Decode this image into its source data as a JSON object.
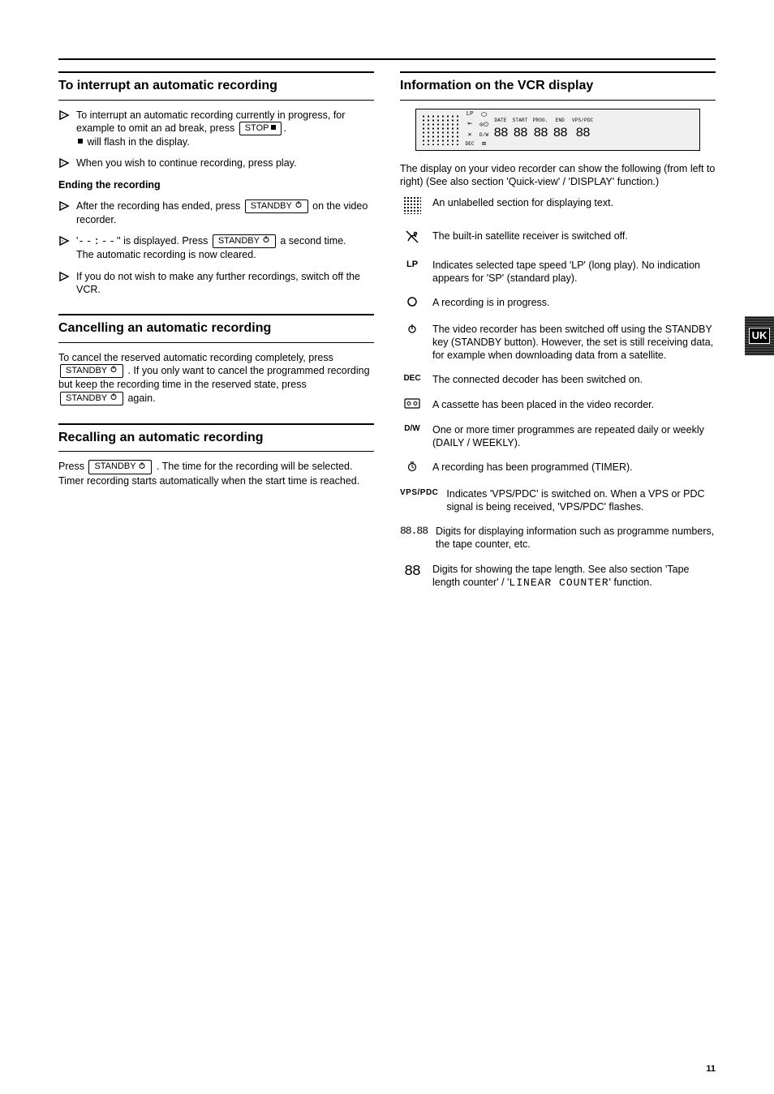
{
  "sections": {
    "interrupt": {
      "title": "To interrupt an automatic recording",
      "step1_a": "To interrupt an automatic recording currently in progress, for example to omit an ad break, press ",
      "stop_text": "STOP ",
      "step1_b": ".",
      "step1_sub": " will flash in the display.",
      "step2": "When you wish to continue recording, press play.",
      "ending_title": "Ending the recording",
      "step3_a": "After the recording has ended, press ",
      "step3_b": " on the video recorder.",
      "step4_a": "'' is displayed. Press ",
      "dashes": "--:--",
      "step4_b": " a second time.",
      "step4_c": "The automatic recording is now cleared.",
      "step5": "If you do not wish to make any further recordings, switch off the VCR."
    },
    "cancelling": {
      "title": "Cancelling an automatic recording",
      "body_a": "To cancel the reserved automatic recording completely, press ",
      "standby_text": "STANDBY ",
      "body_b": ". If you only want to cancel the programmed recording but keep the recording time in the reserved state, press ",
      "body_c": " again."
    },
    "recall": {
      "title": "Recalling an automatic recording",
      "body_a": "Press ",
      "body_b": ". The time for the recording will be selected. Timer recording starts automatically when the start time is reached."
    },
    "indicators": {
      "title": "Information on the VCR display",
      "intro_a": "The display on your video recorder can show the following (from left to right) (See also section 'Quick-view' / ",
      "ref": "DISPLAY",
      "intro_b": " function.)",
      "items": {
        "dots": "An unlabelled section for displaying text.",
        "sat": "The built-in satellite receiver is switched off.",
        "lp": "LP",
        "lp_text": "Indicates selected tape speed 'LP' (long play). No indication appears for 'SP' (standard play).",
        "rec_circle_text": "A recording is in progress.",
        "stdby_text": "The video recorder has been switched off using the STANDBY key (STANDBY button). However, the set is still receiving data, for example when downloading data from a satellite.",
        "dec": "DEC",
        "dec_text": "The connected decoder has been switched on.",
        "cassette_text": "A cassette has been placed in the video recorder.",
        "dw": "D/W",
        "dw_text": "One or more timer programmes are repeated daily or weekly (DAILY / WEEKLY).",
        "timer_icon_text": "A recording has been programmed (TIMER).",
        "vps_text": "Indicates 'VPS/PDC' is switched on. When a VPS or PDC signal is being received, 'VPS/PDC' flashes.",
        "seg_text": "Digits for displaying information such as programme numbers, the tape counter, etc.",
        "counter_intro": "Digits for showing the tape length. See also section 'Tape length counter' / ",
        "counter_ref": "LINEAR COUNTER",
        "counter_end": " function."
      }
    }
  },
  "page_number": "11"
}
